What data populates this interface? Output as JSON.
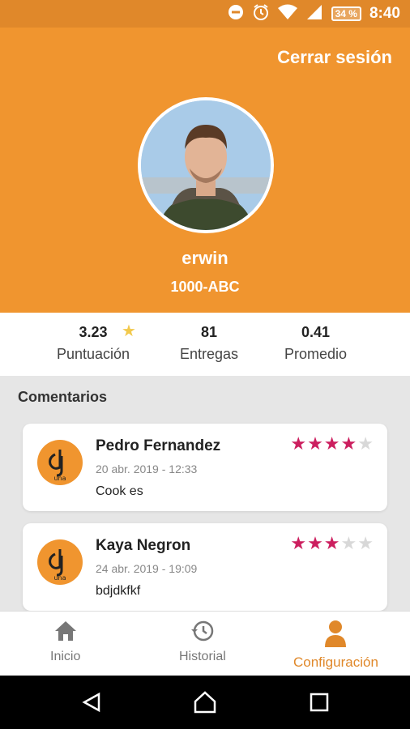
{
  "status": {
    "battery": "34 %",
    "time": "8:40"
  },
  "header": {
    "logout_label": "Cerrar sesión",
    "username": "erwin",
    "code": "1000-ABC"
  },
  "stats": {
    "rating": {
      "value": "3.23",
      "label": "Puntuación"
    },
    "deliveries": {
      "value": "81",
      "label": "Entregas"
    },
    "average": {
      "value": "0.41",
      "label": "Promedio"
    }
  },
  "comments": {
    "title": "Comentarios",
    "items": [
      {
        "name": "Pedro Fernandez",
        "date": "20 abr. 2019 - 12:33",
        "text": "Cook es",
        "rating": 4
      },
      {
        "name": "Kaya Negron",
        "date": "24 abr. 2019 - 19:09",
        "text": "bdjdkfkf",
        "rating": 3
      }
    ]
  },
  "tabs": {
    "inicio": "Inicio",
    "historial": "Historial",
    "configuracion": "Configuración"
  },
  "colors": {
    "accent": "#f0952f",
    "star_on": "#cc1f5f",
    "star_off": "#d8d8d8"
  },
  "icons": [
    "dnd-icon",
    "alarm-icon",
    "wifi-icon",
    "signal-icon",
    "battery-icon",
    "home-icon",
    "history-icon",
    "person-icon",
    "back-icon",
    "home-nav-icon",
    "recents-icon"
  ]
}
